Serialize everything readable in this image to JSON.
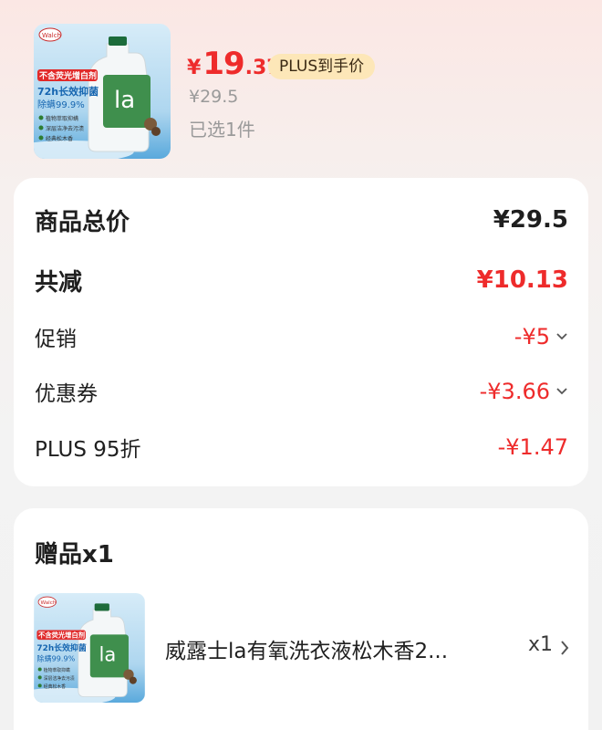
{
  "product": {
    "image_icon": "laundry-detergent-product-image",
    "image_texts": {
      "brand": "Walch",
      "banner": "不含荧光增白剂",
      "headline": "72h长效抑菌",
      "sub": "除螨99.9%",
      "bullets": [
        "植物萃取抑螨",
        "深层洁净去污渍",
        "经典松木香"
      ],
      "bottle_logo": "la"
    },
    "price_symbol": "¥",
    "price_integer": "19",
    "price_decimal": ".37",
    "badge": "PLUS到手价",
    "original_price": "¥29.5",
    "selected": "已选1件"
  },
  "summary": {
    "rows": [
      {
        "label": "商品总价",
        "value": "¥29.5"
      },
      {
        "label": "共减",
        "value": "¥10.13"
      },
      {
        "label": "促销",
        "value": "-¥5",
        "icon": "chevron-down-icon"
      },
      {
        "label": "优惠券",
        "value": "-¥3.66",
        "icon": "chevron-down-icon"
      },
      {
        "label": "PLUS 95折",
        "value": "-¥1.47"
      }
    ]
  },
  "gift": {
    "title": "赠品x1",
    "image_icon": "laundry-detergent-gift-image",
    "name": "威露士la有氧洗衣液松木香2...",
    "quantity": "x1",
    "icon": "chevron-right-icon"
  },
  "colors": {
    "accent_red": "#ee2b2b",
    "plus_badge_bg": "#fde7b8",
    "muted_text": "#9a9a9a"
  }
}
